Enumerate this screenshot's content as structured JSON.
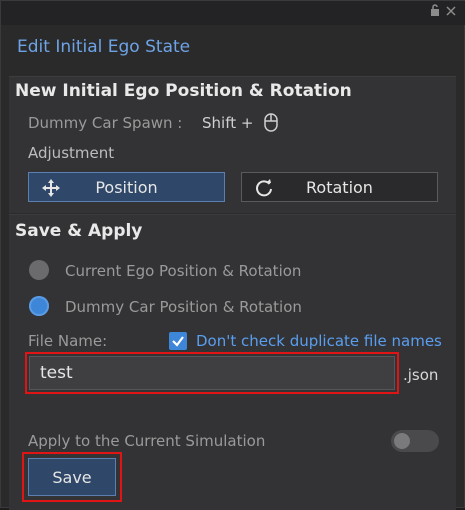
{
  "window": {
    "title": "Edit Initial Ego State"
  },
  "titlebar": {
    "icons": [
      "lock-icon",
      "close-icon"
    ]
  },
  "position_section": {
    "heading": "New Initial Ego Position & Rotation",
    "spawn_label": "Dummy Car Spawn :",
    "spawn_shortcut": "Shift +",
    "shortcut_icon": "mouse-icon",
    "adjustment_label": "Adjustment",
    "position_button": "Position",
    "rotation_button": "Rotation",
    "selected_mode": "Position"
  },
  "save_section": {
    "heading": "Save & Apply",
    "radio_current": "Current Ego Position & Rotation",
    "radio_dummy": "Dummy Car Position & Rotation",
    "selected_option": "Dummy Car Position & Rotation",
    "file_name_label": "File Name:",
    "duplicate_check_label": "Don't check duplicate file names",
    "duplicate_check_checked": true,
    "file_name_value": "test",
    "extension": ".json",
    "apply_label": "Apply to the Current Simulation",
    "apply_enabled": false,
    "save_button": "Save"
  },
  "colors": {
    "accent": "#3e86d8",
    "title": "#6ea3e6",
    "highlight_outline": "#e01414"
  }
}
